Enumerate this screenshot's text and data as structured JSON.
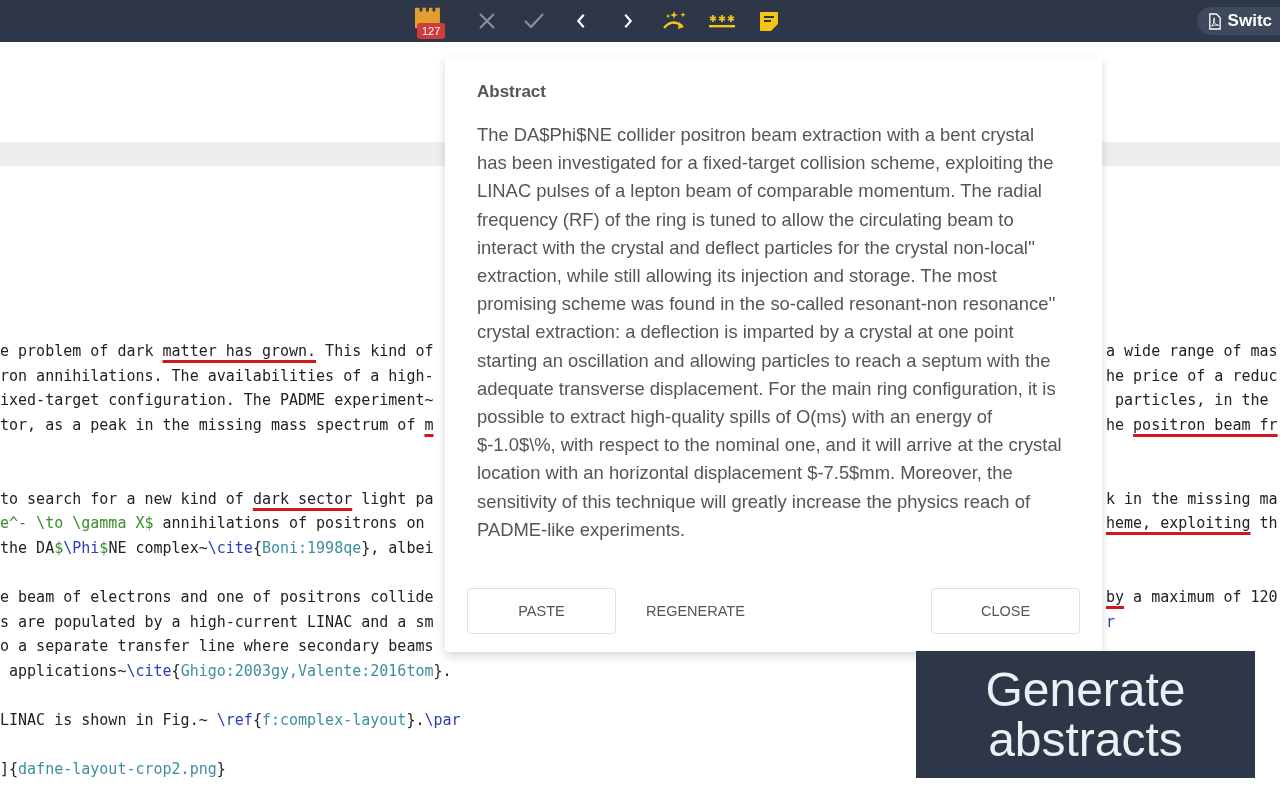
{
  "toolbar": {
    "badge": "127",
    "tools": [
      {
        "kind": "reject",
        "disabled": true
      },
      {
        "kind": "accept",
        "disabled": true
      },
      {
        "kind": "previous",
        "disabled": false
      },
      {
        "kind": "next",
        "disabled": false
      },
      {
        "kind": "sparkle",
        "disabled": false
      },
      {
        "kind": "password",
        "disabled": false
      },
      {
        "kind": "note",
        "disabled": false
      }
    ],
    "switch_button": "Switc"
  },
  "editor": {
    "lines": [
      {
        "kind": "code",
        "left": [
          {
            "kind": "text",
            "text": "e problem of dark "
          },
          {
            "kind": "error",
            "text": "matter has grown."
          },
          {
            "kind": "text",
            "text": " This kind of"
          }
        ],
        "right": [
          {
            "kind": "text",
            "text": "a wide range of mas"
          }
        ]
      },
      {
        "kind": "code",
        "left": [
          {
            "kind": "text",
            "text": "ron annihilations. The availabilities of a high-"
          }
        ],
        "right": [
          {
            "kind": "text",
            "text": "he price of a reduc"
          }
        ]
      },
      {
        "kind": "code",
        "left": [
          {
            "kind": "text",
            "text": "ixed-target configuration. The PADME experiment~"
          }
        ],
        "right": [
          {
            "kind": "text",
            "text": " particles, in the"
          }
        ]
      },
      {
        "kind": "code",
        "left": [
          {
            "kind": "text",
            "text": "tor, as a peak in the missing mass spectrum of "
          },
          {
            "kind": "error",
            "text": "m"
          }
        ],
        "right": [
          {
            "kind": "text",
            "text": "he "
          },
          {
            "kind": "error",
            "text": "positron beam fr"
          }
        ]
      },
      {
        "kind": "blank"
      },
      {
        "kind": "blank"
      },
      {
        "kind": "code",
        "left": [
          {
            "kind": "text",
            "text": "to search for a new kind of "
          },
          {
            "kind": "error",
            "text": "dark sector"
          },
          {
            "kind": "text",
            "text": " light pa"
          }
        ],
        "right": [
          {
            "kind": "text",
            "text": "k in the missing ma"
          }
        ]
      },
      {
        "kind": "code",
        "left": [
          {
            "kind": "math",
            "text": "e^- \\to \\gamma X$"
          },
          {
            "kind": "text",
            "text": " annihilations of positrons on"
          }
        ],
        "right": [
          {
            "kind": "error",
            "text": "heme, exploiting"
          },
          {
            "kind": "text",
            "text": " th"
          }
        ]
      },
      {
        "kind": "code",
        "left": [
          {
            "kind": "text",
            "text": "the DA"
          },
          {
            "kind": "math",
            "text": "$"
          },
          {
            "kind": "command",
            "text": "\\Phi"
          },
          {
            "kind": "math",
            "text": "$"
          },
          {
            "kind": "text",
            "text": "NE complex~"
          },
          {
            "kind": "command",
            "text": "\\cite"
          },
          {
            "kind": "text",
            "text": "{"
          },
          {
            "kind": "arg",
            "text": "Boni:1998qe"
          },
          {
            "kind": "text",
            "text": "}, albei"
          }
        ]
      },
      {
        "kind": "blank"
      },
      {
        "kind": "code",
        "left": [
          {
            "kind": "text",
            "text": "e beam of electrons and one of positrons collide"
          }
        ],
        "right": [
          {
            "kind": "error",
            "text": "by"
          },
          {
            "kind": "text",
            "text": " a maximum of 120"
          }
        ]
      },
      {
        "kind": "code",
        "left": [
          {
            "kind": "text",
            "text": "s are populated by a high-current LINAC and a sm"
          }
        ],
        "right": [
          {
            "kind": "command",
            "text": "r"
          }
        ]
      },
      {
        "kind": "code",
        "left": [
          {
            "kind": "text",
            "text": "o a separate transfer line where secondary beams"
          }
        ]
      },
      {
        "kind": "code",
        "left": [
          {
            "kind": "text",
            "text": " applications~"
          },
          {
            "kind": "command",
            "text": "\\cite"
          },
          {
            "kind": "text",
            "text": "{"
          },
          {
            "kind": "arg",
            "text": "Ghigo:2003gy,Valente:2016tom"
          },
          {
            "kind": "text",
            "text": "}."
          }
        ]
      },
      {
        "kind": "blank"
      },
      {
        "kind": "code",
        "left": [
          {
            "kind": "text",
            "text": "LINAC is shown in Fig.~ "
          },
          {
            "kind": "command",
            "text": "\\ref"
          },
          {
            "kind": "text",
            "text": "{"
          },
          {
            "kind": "arg",
            "text": "f:complex-layout"
          },
          {
            "kind": "text",
            "text": "}."
          },
          {
            "kind": "command",
            "text": "\\par"
          }
        ]
      },
      {
        "kind": "blank"
      },
      {
        "kind": "code",
        "left": [
          {
            "kind": "text",
            "text": "]{"
          },
          {
            "kind": "arg",
            "text": "dafne-layout-crop2.png"
          },
          {
            "kind": "text",
            "text": "}"
          }
        ]
      }
    ]
  },
  "dialog": {
    "title": "Abstract",
    "body": "The DA$Phi$NE collider positron beam extraction with a bent crystal has been investigated for a fixed-target collision scheme, exploiting the LINAC pulses of a lepton beam of comparable momentum. The radial frequency (RF) of the ring is tuned to allow the circulating beam to interact with the crystal and deflect particles for the crystal non-local'' extraction, while still allowing its injection and storage. The most promising scheme was found in the so-called resonant-non resonance'' crystal extraction: a deflection is imparted by a crystal at one point starting an oscillation and allowing particles to reach a septum with the adequate transverse displacement. For the main ring configuration, it is possible to extract high-quality spills of O(ms) with an energy of $-1.0$\\%, with respect to the nominal one, and it will arrive at the crystal location with an horizontal displacement $-7.5$mm. Moreover, the sensitivity of this technique will greatly increase the physics reach of PADME-like experiments.",
    "buttons": [
      {
        "label": "PASTE",
        "kind": "outlined"
      },
      {
        "label": "REGENERATE",
        "kind": "text"
      },
      {
        "label": "CLOSE",
        "kind": "outlined"
      }
    ]
  },
  "tooltip": "Generate abstracts"
}
